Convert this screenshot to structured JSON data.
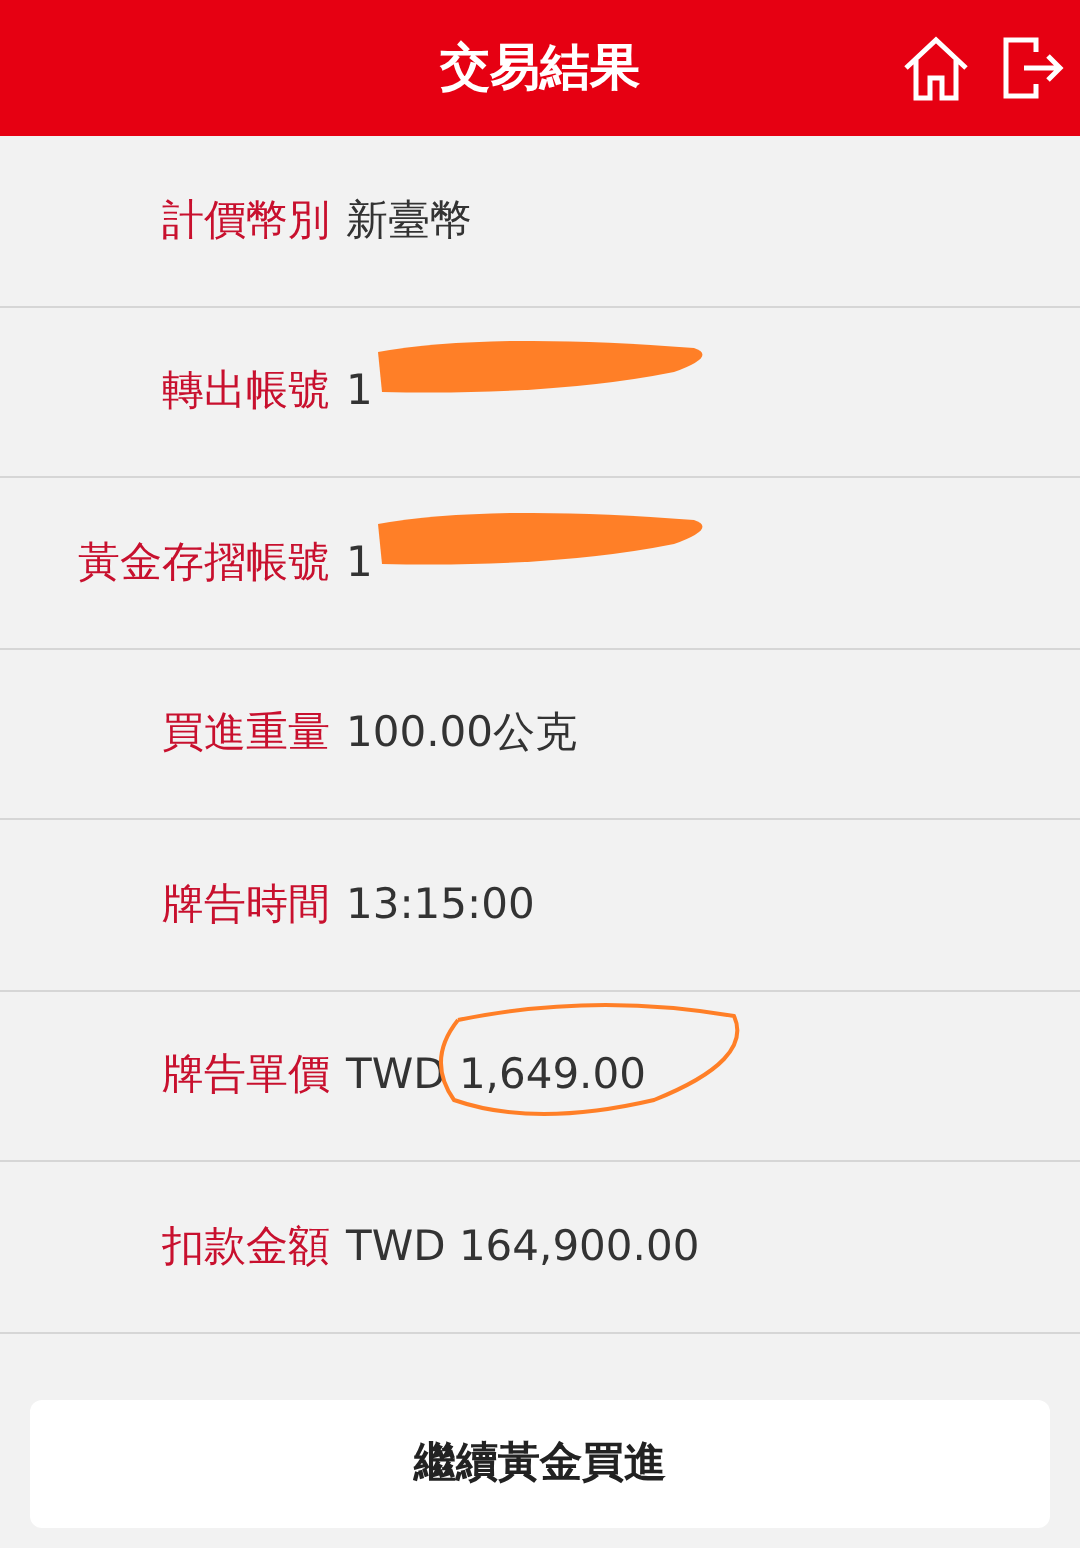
{
  "header": {
    "title": "交易結果"
  },
  "rows": [
    {
      "label": "計價幣別",
      "value": "新臺幣",
      "redacted": false,
      "circled": false
    },
    {
      "label": "轉出帳號",
      "value": "1",
      "redacted": true,
      "circled": false
    },
    {
      "label": "黃金存摺帳號",
      "value": "1",
      "redacted": true,
      "circled": false
    },
    {
      "label": "買進重量",
      "value": "100.00公克",
      "redacted": false,
      "circled": false
    },
    {
      "label": "牌告時間",
      "value": "13:15:00",
      "redacted": false,
      "circled": false
    },
    {
      "label": "牌告單價",
      "value": "TWD 1,649.00",
      "redacted": false,
      "circled": true
    },
    {
      "label": "扣款金額",
      "value": "TWD 164,900.00",
      "redacted": false,
      "circled": false
    }
  ],
  "button": {
    "label": "繼續黃金買進"
  }
}
